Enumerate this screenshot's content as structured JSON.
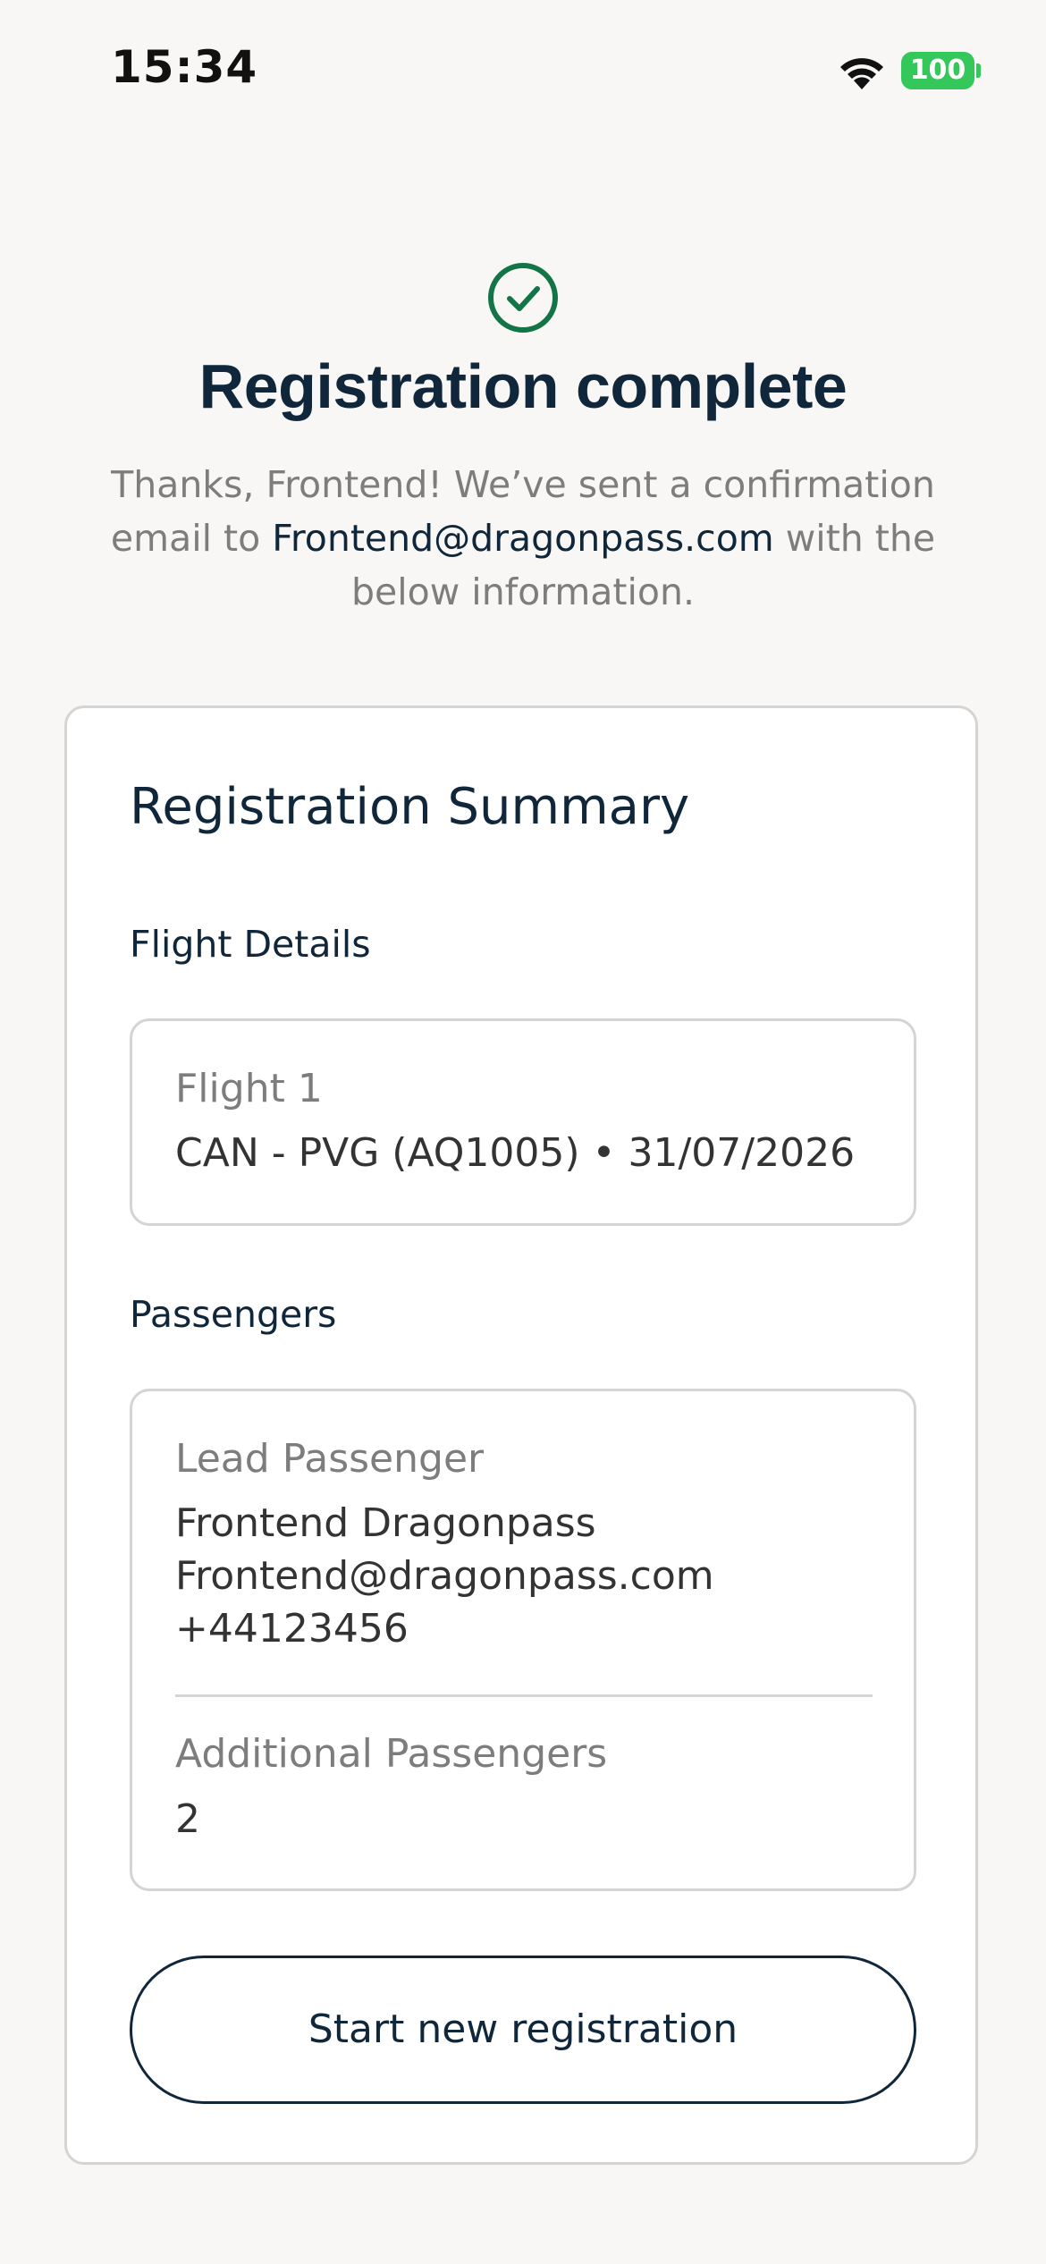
{
  "status_bar": {
    "time": "15:34",
    "battery": "100",
    "icons": [
      "wifi-icon",
      "battery-icon"
    ],
    "battery_color": "#34c759"
  },
  "header": {
    "icon": "check-circle-icon",
    "icon_color": "#137547",
    "title": "Registration complete",
    "intro_before": "Thanks, Frontend! We’ve sent a confirmation email to ",
    "intro_email": "Frontend@dragonpass.com",
    "intro_after": " with the below information."
  },
  "summary": {
    "title": "Registration Summary",
    "flight_section_label": "Flight Details",
    "flight": {
      "label": "Flight 1",
      "value": "CAN - PVG (AQ1005) • 31/07/2026"
    },
    "passengers_section_label": "Passengers",
    "lead": {
      "label": "Lead Passenger",
      "name": "Frontend Dragonpass",
      "email": "Frontend@dragonpass.com",
      "phone": "+44123456"
    },
    "additional": {
      "label": "Additional Passengers",
      "value": "2"
    },
    "button_label": "Start new registration"
  },
  "colors": {
    "background": "#f8f7f5",
    "primary_text": "#10263a",
    "muted_text": "#7d7d7d",
    "border": "#d4d4d4"
  }
}
